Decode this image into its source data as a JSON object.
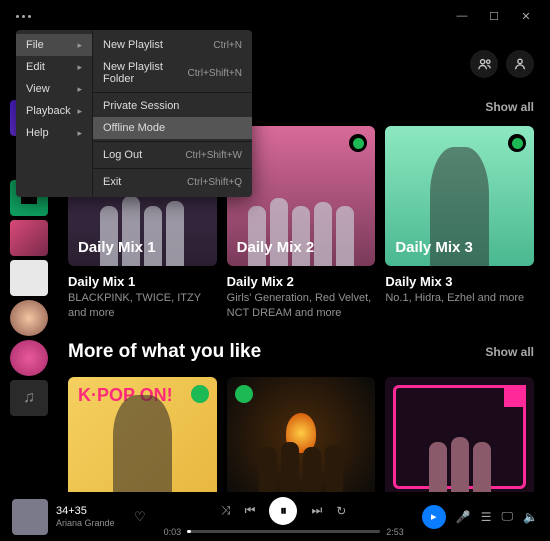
{
  "titlebar": {
    "minimize": "—",
    "maximize": "☐",
    "close": "✕"
  },
  "menu": {
    "col1": [
      {
        "label": "File",
        "arrow": true,
        "hl": true
      },
      {
        "label": "Edit",
        "arrow": true
      },
      {
        "label": "View",
        "arrow": true
      },
      {
        "label": "Playback",
        "arrow": true
      },
      {
        "label": "Help",
        "arrow": true
      }
    ],
    "col2": [
      {
        "label": "New Playlist",
        "shortcut": "Ctrl+N"
      },
      {
        "label": "New Playlist Folder",
        "shortcut": "Ctrl+Shift+N"
      },
      {
        "sep": true
      },
      {
        "label": "Private Session"
      },
      {
        "label": "Offline Mode",
        "hl": true
      },
      {
        "sep": true
      },
      {
        "label": "Log Out",
        "shortcut": "Ctrl+Shift+W"
      },
      {
        "sep": true
      },
      {
        "label": "Exit",
        "shortcut": "Ctrl+Shift+Q"
      }
    ]
  },
  "show_all": "Show all",
  "mixes": [
    {
      "overlay": "Daily Mix 1",
      "title": "Daily Mix 1",
      "sub": "BLACKPINK, TWICE, ITZY and more"
    },
    {
      "overlay": "Daily Mix 2",
      "title": "Daily Mix 2",
      "sub": "Girls' Generation, Red Velvet, NCT DREAM and more"
    },
    {
      "overlay": "Daily Mix 3",
      "title": "Daily Mix 3",
      "sub": "No.1, Hidra, Ezhel and more"
    }
  ],
  "section2_title": "More of what you like",
  "kpop_on": "K·POP ON!",
  "player": {
    "title": "34+35",
    "artist": "Ariana Grande",
    "elapsed": "0:03",
    "total": "2:53"
  }
}
